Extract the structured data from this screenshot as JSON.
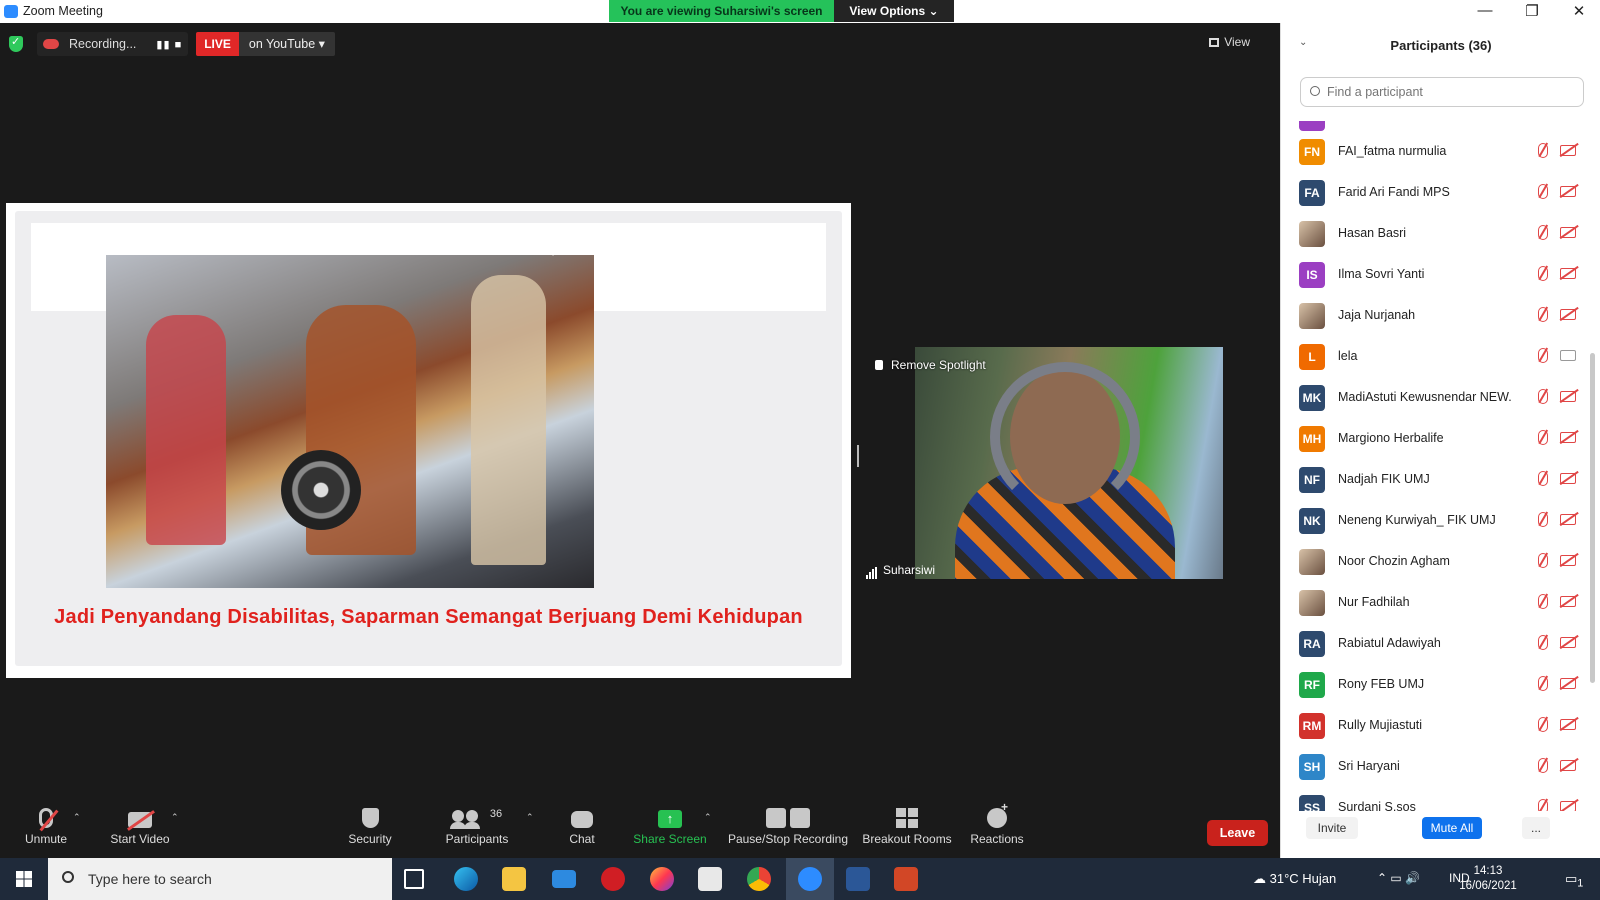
{
  "window": {
    "title": "Zoom Meeting",
    "viewing_banner": "You are viewing Suharsiwi's screen",
    "view_options": "View Options",
    "minimize": "—",
    "restore": "❐",
    "close": "✕"
  },
  "top_bar": {
    "recording_label": "Recording...",
    "recording_controls": "▮▮  ■",
    "live_label": "LIVE",
    "live_destination": "on YouTube",
    "view_label": "View"
  },
  "slide": {
    "caption": "Jadi Penyandang Disabilitas, Saparman Semangat Berjuang Demi Kehidupan"
  },
  "spotlight": {
    "remove_label": "Remove Spotlight",
    "participant_name": "Suharsiwi"
  },
  "toolbar": {
    "unmute": "Unmute",
    "start_video": "Start Video",
    "security": "Security",
    "participants": "Participants",
    "participant_count": "36",
    "chat": "Chat",
    "share_screen": "Share Screen",
    "share_arrow": "↑",
    "pause_recording": "Pause/Stop Recording",
    "breakout_rooms": "Breakout Rooms",
    "reactions": "Reactions",
    "leave": "Leave",
    "caret": "⌃"
  },
  "participants_panel": {
    "title": "Participants (36)",
    "collapse_icon": "⌄",
    "search_placeholder": "Find a participant",
    "participants": [
      {
        "initials": "FN",
        "name": "FAI_fatma nurmulia",
        "color": "#f08c00",
        "video": "off"
      },
      {
        "initials": "FA",
        "name": "Farid Ari Fandi MPS",
        "color": "#2e4a6e",
        "video": "off"
      },
      {
        "initials": "",
        "name": "Hasan Basri",
        "color": "photo",
        "video": "off"
      },
      {
        "initials": "IS",
        "name": "Ilma Sovri Yanti",
        "color": "#9b3fc2",
        "video": "off"
      },
      {
        "initials": "",
        "name": "Jaja Nurjanah",
        "color": "photo",
        "video": "off"
      },
      {
        "initials": "L",
        "name": "lela",
        "color": "#f06a00",
        "video": "on"
      },
      {
        "initials": "MK",
        "name": "MadiAstuti Kewusnendar NEW.",
        "color": "#2e4a6e",
        "video": "off"
      },
      {
        "initials": "MH",
        "name": "Margiono Herbalife",
        "color": "#f07a00",
        "video": "off"
      },
      {
        "initials": "NF",
        "name": "Nadjah FIK UMJ",
        "color": "#2e4a6e",
        "video": "off"
      },
      {
        "initials": "NK",
        "name": "Neneng Kurwiyah_ FIK UMJ",
        "color": "#2e4a6e",
        "video": "off"
      },
      {
        "initials": "",
        "name": "Noor Chozin Agham",
        "color": "photo",
        "video": "off"
      },
      {
        "initials": "",
        "name": "Nur Fadhilah",
        "color": "photo",
        "video": "off"
      },
      {
        "initials": "RA",
        "name": "Rabiatul Adawiyah",
        "color": "#2e4a6e",
        "video": "off"
      },
      {
        "initials": "RF",
        "name": "Rony FEB UMJ",
        "color": "#1fa84a",
        "video": "off"
      },
      {
        "initials": "RM",
        "name": "Rully Mujiastuti",
        "color": "#d2322c",
        "video": "off"
      },
      {
        "initials": "SH",
        "name": "Sri Haryani",
        "color": "#2e86c8",
        "video": "off"
      },
      {
        "initials": "SS",
        "name": "Surdani S.sos",
        "color": "#2e4a6e",
        "video": "off"
      }
    ],
    "invite": "Invite",
    "mute_all": "Mute All",
    "more": "..."
  },
  "taskbar": {
    "search_placeholder": "Type here to search",
    "weather": "31°C  Hujan",
    "language": "IND",
    "time": "14:13",
    "date": "16/06/2021",
    "notifications": "1",
    "tray_icons": "⌃  ▭  🔊"
  }
}
